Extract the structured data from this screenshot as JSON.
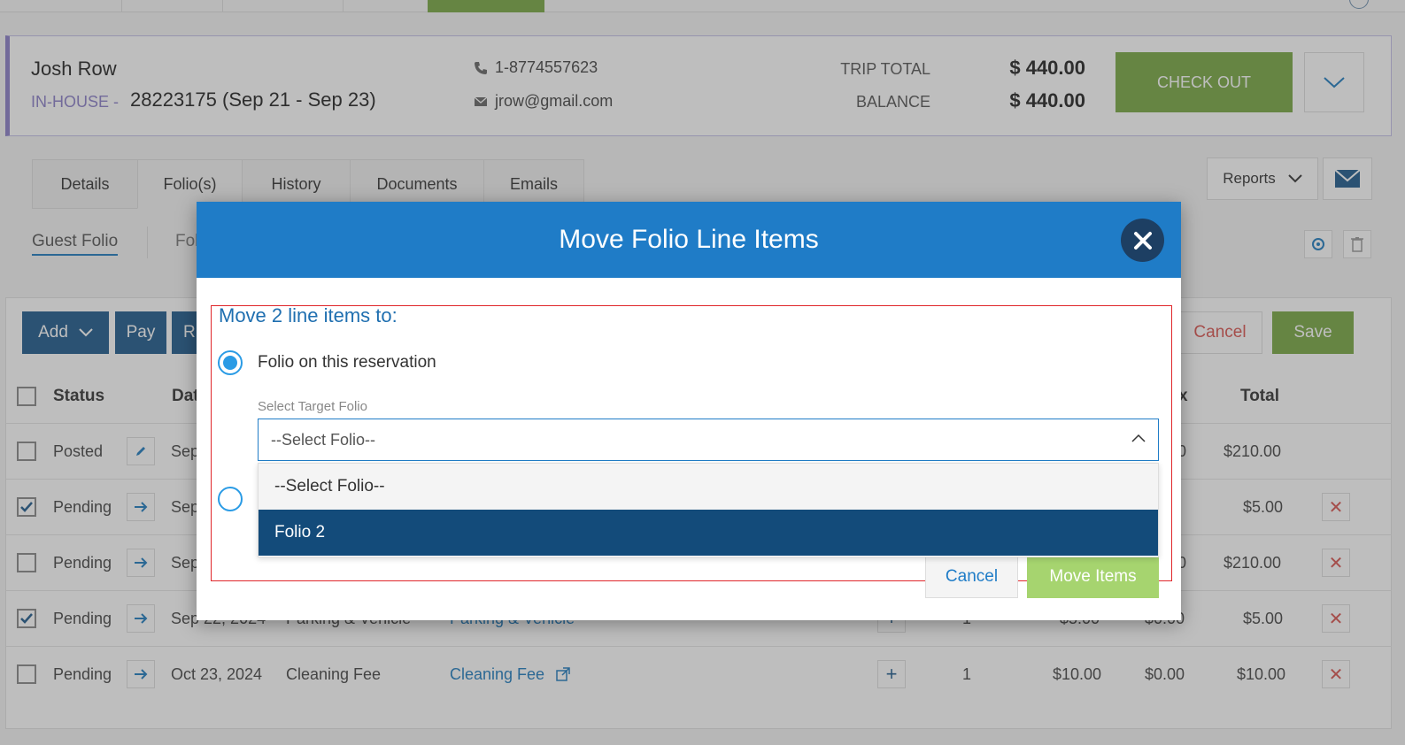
{
  "guest": {
    "name": "Josh Row",
    "status": "IN-HOUSE -",
    "reservation": "28223175 (Sep 21 - Sep 23)",
    "phone": "1-8774557623",
    "email": "jrow@gmail.com",
    "trip_total_label": "TRIP TOTAL",
    "trip_total": "$ 440.00",
    "balance_label": "BALANCE",
    "balance": "$ 440.00",
    "checkout_label": "CHECK OUT"
  },
  "tabs": [
    {
      "label": "Details"
    },
    {
      "label": "Folio(s)"
    },
    {
      "label": "History"
    },
    {
      "label": "Documents"
    },
    {
      "label": "Emails"
    }
  ],
  "reports_label": "Reports",
  "folio_tabs": {
    "active": "Guest Folio",
    "second": "Fol"
  },
  "toolbar": {
    "add": "Add",
    "pay": "Pay",
    "third": "R",
    "cancel": "Cancel",
    "save": "Save"
  },
  "table": {
    "headers": {
      "status": "Status",
      "date": "Dat",
      "tax": "x",
      "total": "Total"
    },
    "rows": [
      {
        "checked": false,
        "status": "Posted",
        "date": "Sep",
        "category": "",
        "item": "",
        "qty": "",
        "price": "",
        "tax": "0",
        "total": "$210.00",
        "action": "edit"
      },
      {
        "checked": true,
        "status": "Pending",
        "date": "Sep",
        "category": "",
        "item": "",
        "qty": "",
        "price": "",
        "tax": "",
        "total": "$5.00",
        "action": "move"
      },
      {
        "checked": false,
        "status": "Pending",
        "date": "Sep",
        "category": "",
        "item": "",
        "qty": "",
        "price": "",
        "tax": "0",
        "total": "$210.00",
        "action": "move"
      },
      {
        "checked": true,
        "status": "Pending",
        "date": "Sep 22, 2024",
        "category": "Parking & Vehicle",
        "item": "Parking & Vehicle",
        "qty": "1",
        "price": "$5.00",
        "tax": "$0.00",
        "total": "$5.00",
        "action": "move"
      },
      {
        "checked": false,
        "status": "Pending",
        "date": "Oct 23, 2024",
        "category": "Cleaning Fee",
        "item": "Cleaning Fee",
        "qty": "1",
        "price": "$10.00",
        "tax": "$0.00",
        "total": "$10.00",
        "action": "move"
      }
    ]
  },
  "modal": {
    "title": "Move Folio Line Items",
    "move_title": "Move 2 line items to:",
    "option1": "Folio on this reservation",
    "field_label": "Select Target Folio",
    "select_value": "--Select Folio--",
    "options": [
      "--Select Folio--",
      "Folio 2"
    ],
    "cancel": "Cancel",
    "move": "Move Items"
  },
  "colors": {
    "primary": "#1f7cc7",
    "dark_blue": "#1e5a8c",
    "green": "#79a843",
    "danger": "#d9534f",
    "purple": "#8a7fc8"
  }
}
